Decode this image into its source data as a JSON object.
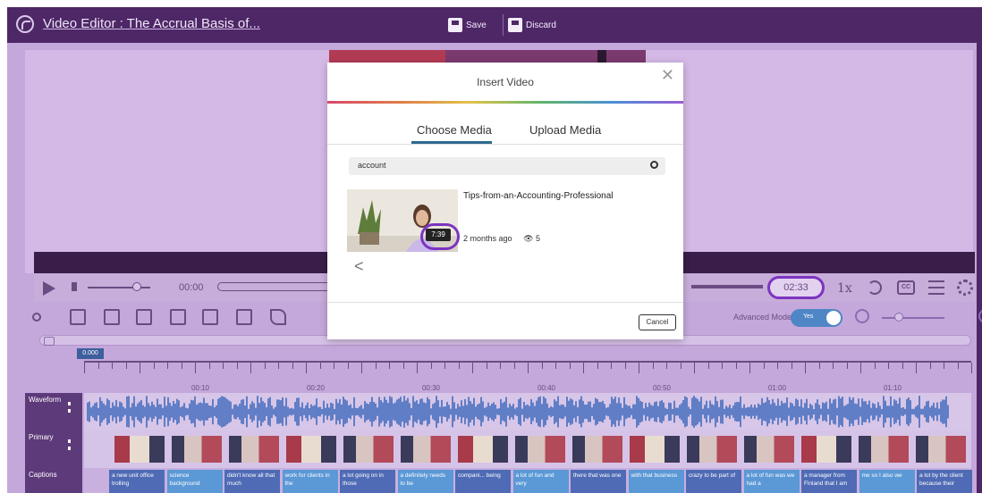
{
  "header": {
    "title": "Video Editor : The Accrual Basis of...",
    "save_label": "Save",
    "discard_label": "Discard"
  },
  "player": {
    "current_time": "00:00",
    "end_time": "02:33",
    "speed": "1x",
    "cc_label": "CC"
  },
  "toolbar": {
    "advanced_mode_label": "Advanced Mode",
    "toggle_label": "Yes",
    "toggle_on": true
  },
  "timeline": {
    "playhead_time": "0.000",
    "ruler_labels": [
      "00:10",
      "00:20",
      "00:30",
      "00:40",
      "00:50",
      "01:00",
      "01:10"
    ],
    "tracks": {
      "waveform": "Waveform",
      "primary": "Primary",
      "captions": "Captions"
    },
    "captions": [
      "a new unit office trolling",
      "science background",
      "didn't know all that much",
      "work for clients in the",
      "a lot going on in those",
      "a definitely needs to be",
      "compani... being",
      "a lot of fun and very",
      "there that was one",
      "with that business",
      "crazy to be part of",
      "a lot of fun was we had a",
      "a manager from Finland that I am",
      "me so I also we",
      "a lot by the client because their"
    ]
  },
  "modal": {
    "title": "Insert Video",
    "tabs": [
      "Choose Media",
      "Upload Media"
    ],
    "active_tab": "Choose Media",
    "search_value": "account",
    "result": {
      "title": "Tips-from-an-Accounting-Professional",
      "duration": "7:39",
      "age": "2 months ago",
      "views": "5"
    },
    "cancel_label": "Cancel"
  },
  "colors": {
    "brand": "#4e2767",
    "accent_ring": "#7c34c0",
    "toggle": "#4f86c6",
    "caption_dark": "#4f6bb5",
    "caption_light": "#5b98d6"
  }
}
